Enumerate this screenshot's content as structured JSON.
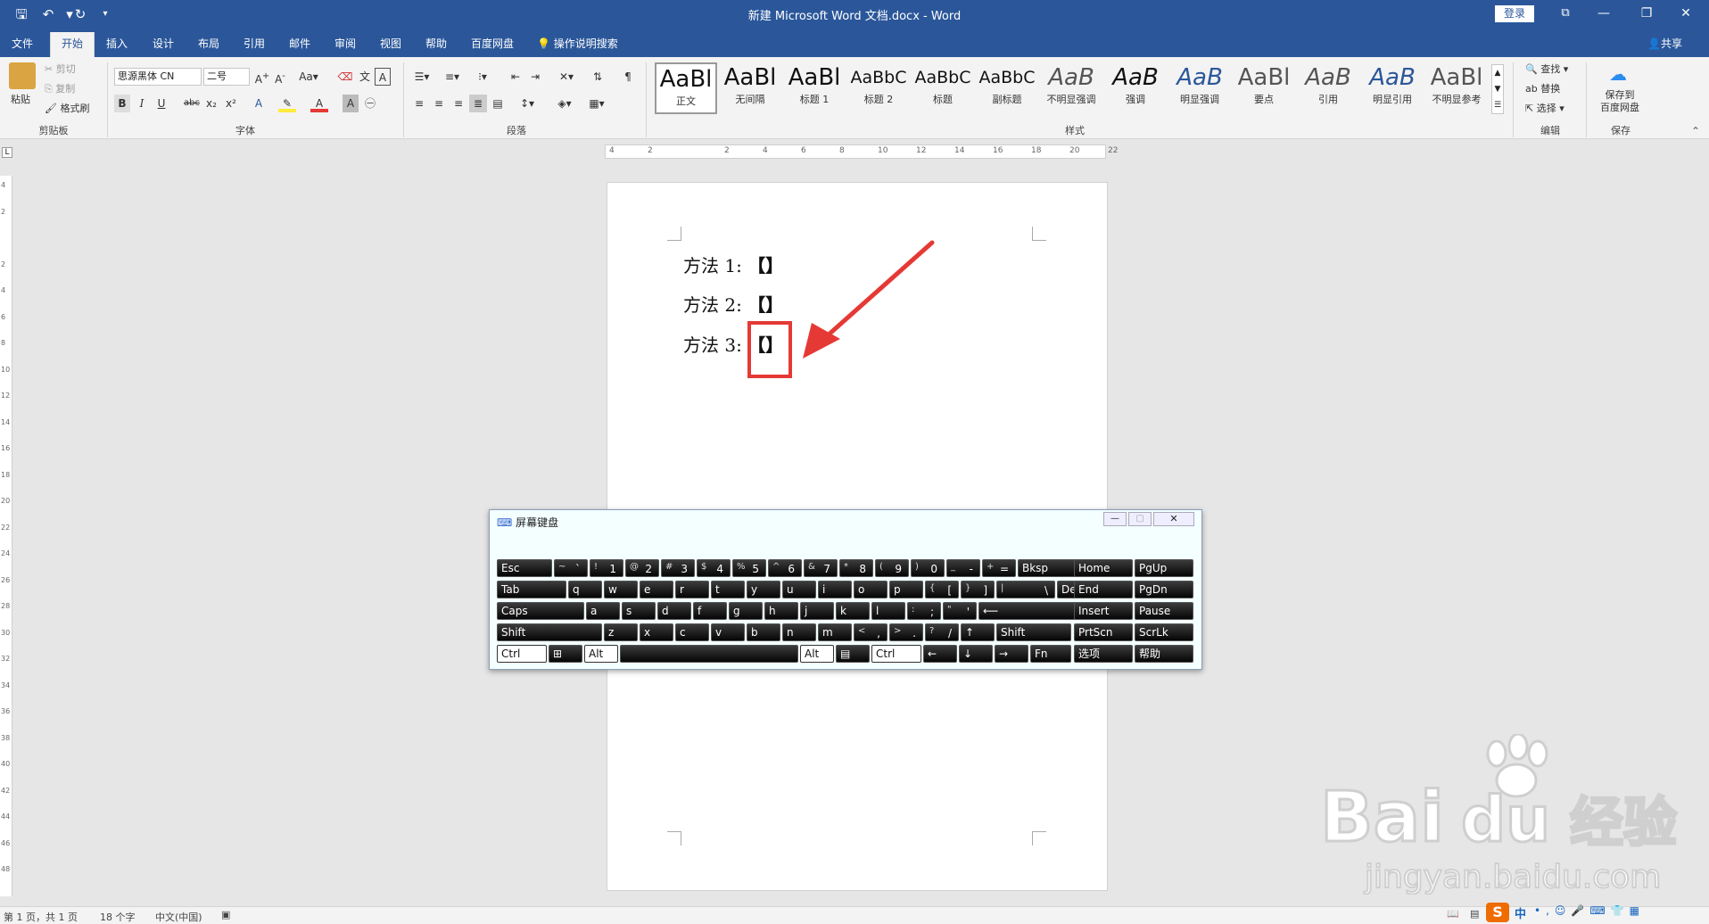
{
  "window": {
    "title": "新建 Microsoft Word 文档.docx  -  Word",
    "login": "登录"
  },
  "tabs": [
    "文件",
    "开始",
    "插入",
    "设计",
    "布局",
    "引用",
    "邮件",
    "审阅",
    "视图",
    "帮助",
    "百度网盘"
  ],
  "tellme": "操作说明搜索",
  "share": "共享",
  "clipboard": {
    "paste": "粘贴",
    "cut": "剪切",
    "copy": "复制",
    "format_painter": "格式刷",
    "label": "剪贴板"
  },
  "font": {
    "name": "思源黑体 CN",
    "size": "二号",
    "label": "字体",
    "bold": "B",
    "italic": "I",
    "underline": "U",
    "strike": "abc",
    "sub": "x₂",
    "sup": "x²"
  },
  "paragraph": {
    "label": "段落"
  },
  "styles": {
    "label": "样式",
    "items": [
      {
        "preview": "AaBl",
        "name": "正文"
      },
      {
        "preview": "AaBl",
        "name": "无间隔"
      },
      {
        "preview": "AaBl",
        "name": "标题 1"
      },
      {
        "preview": "AaBbC",
        "name": "标题 2"
      },
      {
        "preview": "AaBbC",
        "name": "标题"
      },
      {
        "preview": "AaBbC",
        "name": "副标题"
      },
      {
        "preview": "AaB",
        "name": "不明显强调"
      },
      {
        "preview": "AaB",
        "name": "强调"
      },
      {
        "preview": "AaB",
        "name": "明显强调"
      },
      {
        "preview": "AaBl",
        "name": "要点"
      },
      {
        "preview": "AaB",
        "name": "引用"
      },
      {
        "preview": "AaB",
        "name": "明显引用"
      },
      {
        "preview": "AaBl",
        "name": "不明显参考"
      }
    ]
  },
  "editing": {
    "find": "查找",
    "replace": "替换",
    "select": "选择",
    "label": "编辑"
  },
  "save": {
    "btn_line1": "保存到",
    "btn_line2": "百度网盘",
    "label": "保存"
  },
  "ruler_ticks": [
    "4",
    "2",
    "",
    "2",
    "4",
    "6",
    "8",
    "10",
    "12",
    "14",
    "16",
    "18",
    "20",
    "22"
  ],
  "vruler_ticks": [
    "4",
    "2",
    "",
    "2",
    "4",
    "6",
    "8",
    "10",
    "12",
    "14",
    "16",
    "18",
    "20",
    "22",
    "24",
    "26",
    "28",
    "30",
    "32",
    "34",
    "36",
    "38",
    "40",
    "42",
    "44",
    "46",
    "48"
  ],
  "document": {
    "lines": [
      {
        "label": "方法 1:",
        "symbol": "【】"
      },
      {
        "label": "方法 2:",
        "symbol": "【】"
      },
      {
        "label": "方法 3:",
        "symbol": "【】"
      }
    ]
  },
  "osk": {
    "title": "屏幕键盘",
    "rows": [
      [
        {
          "t": "Esc"
        },
        {
          "s": "~",
          "m": "`"
        },
        {
          "s": "!",
          "m": "1"
        },
        {
          "s": "@",
          "m": "2"
        },
        {
          "s": "#",
          "m": "3"
        },
        {
          "s": "$",
          "m": "4"
        },
        {
          "s": "%",
          "m": "5"
        },
        {
          "s": "^",
          "m": "6"
        },
        {
          "s": "&",
          "m": "7"
        },
        {
          "s": "*",
          "m": "8"
        },
        {
          "s": "(",
          "m": "9"
        },
        {
          "s": ")",
          "m": "0"
        },
        {
          "s": "_",
          "m": "-"
        },
        {
          "s": "+",
          "m": "="
        },
        {
          "t": "Bksp"
        },
        {
          "t": "Home"
        },
        {
          "t": "PgUp"
        }
      ],
      [
        {
          "t": "Tab"
        },
        {
          "t": "q"
        },
        {
          "t": "w"
        },
        {
          "t": "e"
        },
        {
          "t": "r"
        },
        {
          "t": "t"
        },
        {
          "t": "y"
        },
        {
          "t": "u"
        },
        {
          "t": "i"
        },
        {
          "t": "o"
        },
        {
          "t": "p"
        },
        {
          "s": "{",
          "m": "["
        },
        {
          "s": "}",
          "m": "]"
        },
        {
          "s": "|",
          "m": "\\"
        },
        {
          "t": "Del"
        },
        {
          "t": "End"
        },
        {
          "t": "PgDn"
        }
      ],
      [
        {
          "t": "Caps"
        },
        {
          "t": "a"
        },
        {
          "t": "s"
        },
        {
          "t": "d"
        },
        {
          "t": "f"
        },
        {
          "t": "g"
        },
        {
          "t": "h"
        },
        {
          "t": "j"
        },
        {
          "t": "k"
        },
        {
          "t": "l"
        },
        {
          "s": ":",
          "m": ";"
        },
        {
          "s": "\"",
          "m": "'"
        },
        {
          "t": "⟵"
        },
        {
          "t": "Insert"
        },
        {
          "t": "Pause"
        }
      ],
      [
        {
          "t": "Shift"
        },
        {
          "t": "z"
        },
        {
          "t": "x"
        },
        {
          "t": "c"
        },
        {
          "t": "v"
        },
        {
          "t": "b"
        },
        {
          "t": "n"
        },
        {
          "t": "m"
        },
        {
          "s": "<",
          "m": ","
        },
        {
          "s": ">",
          "m": "."
        },
        {
          "s": "?",
          "m": "/"
        },
        {
          "t": "↑"
        },
        {
          "t": "Shift"
        },
        {
          "t": "PrtScn"
        },
        {
          "t": "ScrLk"
        }
      ],
      [
        {
          "t": "Ctrl",
          "w": 1
        },
        {
          "t": "⊞"
        },
        {
          "t": "Alt",
          "w": 1
        },
        {
          "t": ""
        },
        {
          "t": "Alt",
          "w": 1
        },
        {
          "t": "▤"
        },
        {
          "t": "Ctrl",
          "w": 1
        },
        {
          "t": "←"
        },
        {
          "t": "↓"
        },
        {
          "t": "→"
        },
        {
          "t": "Fn"
        },
        {
          "t": "选项"
        },
        {
          "t": "帮助"
        }
      ]
    ]
  },
  "status": {
    "page": "第 1 页，共 1 页",
    "words": "18 个字",
    "lang": "中文(中国)"
  },
  "ime": {
    "logo": "S",
    "mode": "中"
  },
  "watermark": {
    "brand": "Bai",
    "brand2": "du",
    "cn": "经验",
    "url": "jingyan.baidu.com"
  },
  "colors": {
    "accent": "#2b579a",
    "highlight": "#e53935"
  }
}
